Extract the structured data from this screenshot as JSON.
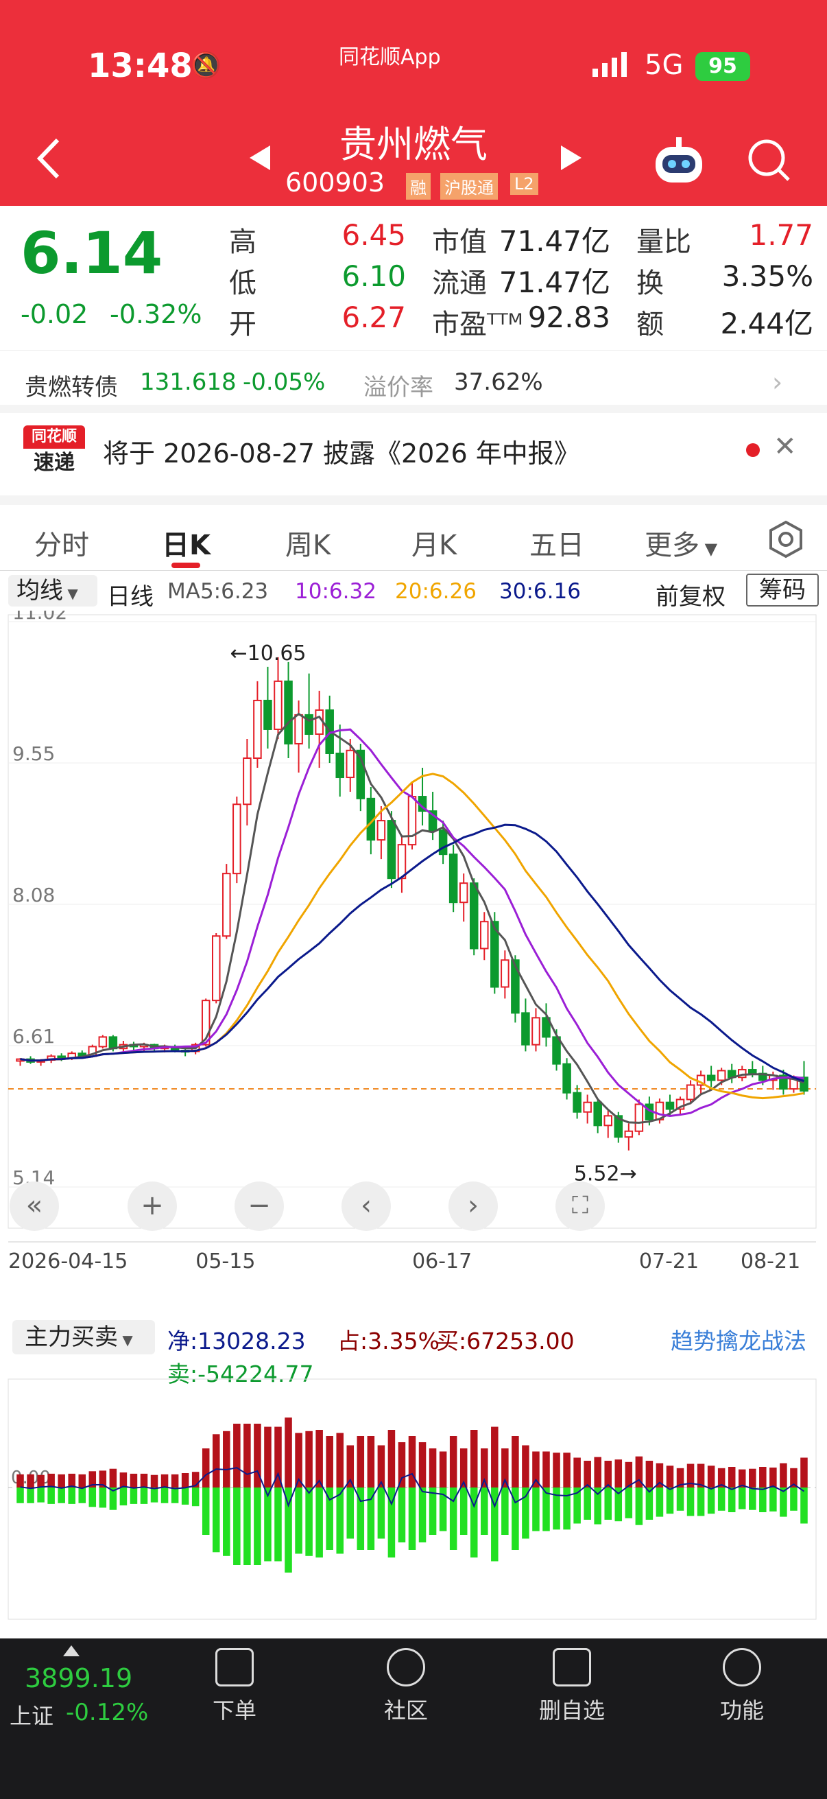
{
  "status_bar": {
    "time": "13:48",
    "app_label": "同花顺App",
    "network": "5G",
    "battery": "95"
  },
  "header": {
    "stock_name": "贵州燃气",
    "stock_code": "600903",
    "tags": [
      "融",
      "沪股通",
      "L2"
    ]
  },
  "quote": {
    "price": "6.14",
    "change": "-0.02",
    "change_pct": "-0.32%",
    "high_label": "高",
    "high": "6.45",
    "low_label": "低",
    "low": "6.10",
    "open_label": "开",
    "open": "6.27",
    "mktcap_label": "市值",
    "mktcap": "71.47亿",
    "float_label": "流通",
    "float": "71.47亿",
    "pe_label": "市盈ᵀᵀᴹ",
    "pe": "92.83",
    "volratio_label": "量比",
    "volratio": "1.77",
    "turnover_label": "换",
    "turnover": "3.35%",
    "amount_label": "额",
    "amount": "2.44亿"
  },
  "bond": {
    "name": "贵燃转债",
    "price": "131.618",
    "change": "-0.05%",
    "premium_label": "溢价率",
    "premium": "37.62%"
  },
  "notice": {
    "logo_top": "同花顺",
    "logo_bottom": "速递",
    "text": "将于 2026-08-27 披露《2026 年中报》"
  },
  "tabs": [
    "分时",
    "日K",
    "周K",
    "月K",
    "五日",
    "更多"
  ],
  "active_tab": 1,
  "ma_bar": {
    "indicator": "均线",
    "period": "日线",
    "ma5": "MA5:6.23",
    "ma10": "10:6.32",
    "ma20": "20:6.26",
    "ma30": "30:6.16",
    "adjust": "前复权",
    "chips": "筹码"
  },
  "colors": {
    "up": "#e41f28",
    "down": "#0c9a2e",
    "ma5": "#555555",
    "ma10": "#9b1fd6",
    "ma20": "#f0a500",
    "ma30": "#0b1a8c",
    "header": "#ec2f3b"
  },
  "chart_data": {
    "type": "candlestick",
    "y_ticks": [
      "11.02",
      "9.55",
      "8.08",
      "6.61",
      "5.14"
    ],
    "x_ticks": [
      "2026-04-15",
      "05-15",
      "06-17",
      "07-21",
      "08-21"
    ],
    "max_label": "←10.65",
    "min_label": "5.52→",
    "ylim": [
      5.14,
      11.02
    ],
    "ref_price": 6.16,
    "candles": [
      [
        6.45,
        6.48,
        6.4,
        6.47
      ],
      [
        6.47,
        6.5,
        6.42,
        6.44
      ],
      [
        6.44,
        6.47,
        6.4,
        6.46
      ],
      [
        6.46,
        6.52,
        6.43,
        6.5
      ],
      [
        6.5,
        6.53,
        6.45,
        6.48
      ],
      [
        6.48,
        6.55,
        6.46,
        6.53
      ],
      [
        6.53,
        6.56,
        6.48,
        6.5
      ],
      [
        6.5,
        6.62,
        6.49,
        6.6
      ],
      [
        6.6,
        6.72,
        6.58,
        6.7
      ],
      [
        6.7,
        6.72,
        6.55,
        6.58
      ],
      [
        6.58,
        6.66,
        6.55,
        6.62
      ],
      [
        6.62,
        6.65,
        6.56,
        6.6
      ],
      [
        6.6,
        6.64,
        6.55,
        6.62
      ],
      [
        6.62,
        6.63,
        6.56,
        6.58
      ],
      [
        6.58,
        6.62,
        6.54,
        6.6
      ],
      [
        6.6,
        6.62,
        6.54,
        6.56
      ],
      [
        6.56,
        6.6,
        6.5,
        6.55
      ],
      [
        6.55,
        6.64,
        6.52,
        6.62
      ],
      [
        6.62,
        7.1,
        6.6,
        7.08
      ],
      [
        7.08,
        7.78,
        7.05,
        7.75
      ],
      [
        7.75,
        8.5,
        7.72,
        8.4
      ],
      [
        8.4,
        9.2,
        8.3,
        9.12
      ],
      [
        9.12,
        9.8,
        8.9,
        9.6
      ],
      [
        9.6,
        10.4,
        9.5,
        10.2
      ],
      [
        10.2,
        10.55,
        9.7,
        9.9
      ],
      [
        9.9,
        10.65,
        9.8,
        10.4
      ],
      [
        10.4,
        10.6,
        9.6,
        9.75
      ],
      [
        9.75,
        10.2,
        9.45,
        10.05
      ],
      [
        10.05,
        10.48,
        9.7,
        9.85
      ],
      [
        9.85,
        10.3,
        9.5,
        10.1
      ],
      [
        10.1,
        10.25,
        9.55,
        9.65
      ],
      [
        9.65,
        9.95,
        9.2,
        9.4
      ],
      [
        9.4,
        9.8,
        9.25,
        9.68
      ],
      [
        9.68,
        9.75,
        9.05,
        9.18
      ],
      [
        9.18,
        9.3,
        8.6,
        8.75
      ],
      [
        8.75,
        9.1,
        8.55,
        8.95
      ],
      [
        8.95,
        9.05,
        8.25,
        8.35
      ],
      [
        8.35,
        8.8,
        8.2,
        8.7
      ],
      [
        8.7,
        9.35,
        8.65,
        9.2
      ],
      [
        9.2,
        9.5,
        8.9,
        9.05
      ],
      [
        9.05,
        9.25,
        8.75,
        8.85
      ],
      [
        8.85,
        8.95,
        8.5,
        8.6
      ],
      [
        8.6,
        8.7,
        8.0,
        8.1
      ],
      [
        8.1,
        8.4,
        7.9,
        8.3
      ],
      [
        8.3,
        8.35,
        7.55,
        7.62
      ],
      [
        7.62,
        8.0,
        7.5,
        7.9
      ],
      [
        7.9,
        8.0,
        7.15,
        7.22
      ],
      [
        7.22,
        7.6,
        7.1,
        7.5
      ],
      [
        7.5,
        7.55,
        6.85,
        6.95
      ],
      [
        6.95,
        7.1,
        6.55,
        6.62
      ],
      [
        6.62,
        7.0,
        6.55,
        6.9
      ],
      [
        6.9,
        7.05,
        6.6,
        6.7
      ],
      [
        6.7,
        6.78,
        6.35,
        6.42
      ],
      [
        6.42,
        6.48,
        6.05,
        6.12
      ],
      [
        6.12,
        6.2,
        5.85,
        5.92
      ],
      [
        5.92,
        6.1,
        5.8,
        6.02
      ],
      [
        6.02,
        6.06,
        5.7,
        5.78
      ],
      [
        5.78,
        5.95,
        5.65,
        5.88
      ],
      [
        5.88,
        5.92,
        5.6,
        5.66
      ],
      [
        5.66,
        5.8,
        5.52,
        5.72
      ],
      [
        5.72,
        6.05,
        5.68,
        6.0
      ],
      [
        6.0,
        6.08,
        5.78,
        5.84
      ],
      [
        5.84,
        6.06,
        5.8,
        6.02
      ],
      [
        6.02,
        6.1,
        5.88,
        5.95
      ],
      [
        5.95,
        6.08,
        5.9,
        6.05
      ],
      [
        6.05,
        6.25,
        6.0,
        6.2
      ],
      [
        6.2,
        6.35,
        6.1,
        6.3
      ],
      [
        6.3,
        6.4,
        6.18,
        6.25
      ],
      [
        6.25,
        6.38,
        6.2,
        6.35
      ],
      [
        6.35,
        6.42,
        6.22,
        6.28
      ],
      [
        6.28,
        6.4,
        6.24,
        6.36
      ],
      [
        6.36,
        6.45,
        6.28,
        6.32
      ],
      [
        6.32,
        6.4,
        6.2,
        6.25
      ],
      [
        6.25,
        6.34,
        6.15,
        6.3
      ],
      [
        6.3,
        6.36,
        6.1,
        6.16
      ],
      [
        6.16,
        6.3,
        6.12,
        6.28
      ],
      [
        6.28,
        6.45,
        6.1,
        6.14
      ]
    ]
  },
  "lower": {
    "indicator": "主力买卖",
    "net": "净:13028.23",
    "share": "占:3.35%",
    "buy": "买:67253.00",
    "sell": "卖:-54224.77",
    "link": "趋势擒龙战法",
    "zero_label": "0.00"
  },
  "bottom_nav": {
    "index_value": "3899.19",
    "index_name": "上证",
    "index_change": "-0.12%",
    "items": [
      "下单",
      "社区",
      "删自选",
      "功能"
    ]
  }
}
